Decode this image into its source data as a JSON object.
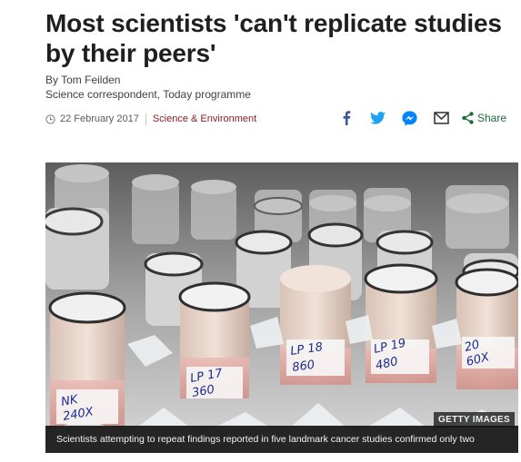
{
  "article": {
    "headline": "Most scientists 'can't replicate studies by their peers'",
    "author": "By Tom Feilden",
    "author_role": "Science correspondent, Today programme",
    "date": "22 February 2017",
    "section": "Science & Environment"
  },
  "share": {
    "label": "Share",
    "icons": [
      "facebook-icon",
      "twitter-icon",
      "messenger-icon",
      "email-icon",
      "share-icon"
    ]
  },
  "image": {
    "credit": "GETTY IMAGES",
    "caption": "Scientists attempting to repeat findings reported in five landmark cancer studies confirmed only two",
    "vial_labels": [
      {
        "l1": "LP 18",
        "l2": "860"
      },
      {
        "l1": "LP 17",
        "l2": "360"
      },
      {
        "l1": "LP 19",
        "l2": "480"
      },
      {
        "l1": "NK",
        "l2": "240X"
      },
      {
        "l1": "20",
        "l2": "60X"
      }
    ]
  },
  "colors": {
    "section": "#8a1c1c",
    "share_green": "#1d6a3a",
    "facebook": "#3b5998",
    "twitter": "#1da1f2",
    "messenger": "#0084ff"
  }
}
